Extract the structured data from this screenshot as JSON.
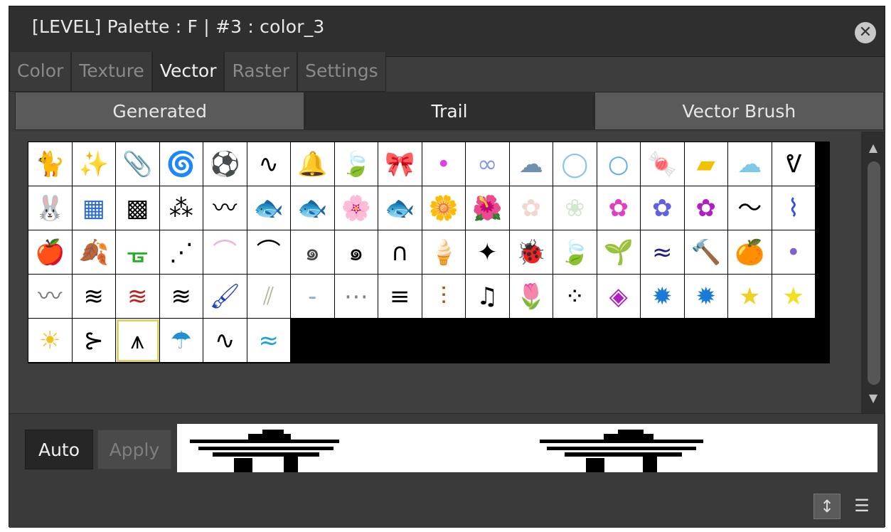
{
  "window": {
    "title": "[LEVEL]  Palette : F | #3 : color_3",
    "close_icon": "close-icon"
  },
  "tabs": [
    "Color",
    "Texture",
    "Vector",
    "Raster",
    "Settings"
  ],
  "active_tab": "Vector",
  "subtabs": [
    "Generated",
    "Trail",
    "Vector Brush"
  ],
  "active_subtab": "Trail",
  "brush_grid": {
    "selected_index": 74,
    "items": [
      {
        "glyph": "🐈",
        "color": "#000000"
      },
      {
        "glyph": "✨",
        "color": "#a020f0"
      },
      {
        "glyph": "📎",
        "color": "#b0b0b0"
      },
      {
        "glyph": "🌀",
        "color": "#555555"
      },
      {
        "glyph": "⚽",
        "color": "#000000"
      },
      {
        "glyph": "∿",
        "color": "#000000"
      },
      {
        "glyph": "🔔",
        "color": "#e0b050"
      },
      {
        "glyph": "🍃",
        "color": "#22a022"
      },
      {
        "glyph": "🎀",
        "color": "#6a6"
      },
      {
        "glyph": "•",
        "color": "#e040e0"
      },
      {
        "glyph": "∞",
        "color": "#8899dd"
      },
      {
        "glyph": "☁",
        "color": "#7090b0"
      },
      {
        "glyph": "◯",
        "color": "#88c4ee"
      },
      {
        "glyph": "○",
        "color": "#66b0e0"
      },
      {
        "glyph": "🍬",
        "color": "#e07010"
      },
      {
        "glyph": "▰",
        "color": "#f2c200"
      },
      {
        "glyph": "☁",
        "color": "#7ec8e8"
      },
      {
        "glyph": "ᕓ",
        "color": "#000000"
      },
      {
        "glyph": "🐰",
        "color": "#e07a30"
      },
      {
        "glyph": "▦",
        "color": "#2a6ad0"
      },
      {
        "glyph": "▩",
        "color": "#000000"
      },
      {
        "glyph": "⁂",
        "color": "#000000"
      },
      {
        "glyph": "〰",
        "color": "#000000"
      },
      {
        "glyph": "🐟",
        "color": "#f0a020"
      },
      {
        "glyph": "🐟",
        "color": "#e03030"
      },
      {
        "glyph": "🌸",
        "color": "#d040a0"
      },
      {
        "glyph": "🐟",
        "color": "#5ab0e0"
      },
      {
        "glyph": "🌼",
        "color": "#f060d0"
      },
      {
        "glyph": "🌺",
        "color": "#e02060"
      },
      {
        "glyph": "✿",
        "color": "#f0d8d0"
      },
      {
        "glyph": "❀",
        "color": "#d0e8d0"
      },
      {
        "glyph": "✿",
        "color": "#e040c0"
      },
      {
        "glyph": "✿",
        "color": "#6060e0"
      },
      {
        "glyph": "✿",
        "color": "#b020c0"
      },
      {
        "glyph": "〜",
        "color": "#000000"
      },
      {
        "glyph": "⌇",
        "color": "#3050e0"
      },
      {
        "glyph": "🍎",
        "color": "#e02020"
      },
      {
        "glyph": "🍂",
        "color": "#f0c000"
      },
      {
        "glyph": "ᚗ",
        "color": "#20b020"
      },
      {
        "glyph": "⋰",
        "color": "#000000"
      },
      {
        "glyph": "⌒",
        "color": "#f0b0e0"
      },
      {
        "glyph": "⌒",
        "color": "#000000"
      },
      {
        "glyph": "๑",
        "color": "#444444"
      },
      {
        "glyph": "๑",
        "color": "#000000"
      },
      {
        "glyph": "∩",
        "color": "#000000"
      },
      {
        "glyph": "🍦",
        "color": "#f0a0b0"
      },
      {
        "glyph": "✦",
        "color": "#000000"
      },
      {
        "glyph": "🐞",
        "color": "#c01020"
      },
      {
        "glyph": "🍃",
        "color": "#208040"
      },
      {
        "glyph": "🌱",
        "color": "#40c040"
      },
      {
        "glyph": "≈",
        "color": "#202080"
      },
      {
        "glyph": "🔨",
        "color": "#1a8ad8"
      },
      {
        "glyph": "🍊",
        "color": "#f08000"
      },
      {
        "glyph": "•",
        "color": "#8060d0"
      },
      {
        "glyph": "〰",
        "color": "#777777"
      },
      {
        "glyph": "≋",
        "color": "#000000"
      },
      {
        "glyph": "≋",
        "color": "#c02020"
      },
      {
        "glyph": "≋",
        "color": "#000000"
      },
      {
        "glyph": "🖌",
        "color": "#2040c0"
      },
      {
        "glyph": "⫽",
        "color": "#b0b8a0"
      },
      {
        "glyph": "-",
        "color": "#80b0d0"
      },
      {
        "glyph": "⋯",
        "color": "#808080"
      },
      {
        "glyph": "≡",
        "color": "#000000"
      },
      {
        "glyph": "⫶",
        "color": "#b05010"
      },
      {
        "glyph": "♫",
        "color": "#000000"
      },
      {
        "glyph": "🌷",
        "color": "#e02020"
      },
      {
        "glyph": "⁘",
        "color": "#000000"
      },
      {
        "glyph": "◈",
        "color": "#b020c0"
      },
      {
        "glyph": "✹",
        "color": "#1a7ad8"
      },
      {
        "glyph": "✹",
        "color": "#1a7ad8"
      },
      {
        "glyph": "★",
        "color": "#f0d020"
      },
      {
        "glyph": "★",
        "color": "#f0e020"
      },
      {
        "glyph": "☀",
        "color": "#f0c020"
      },
      {
        "glyph": "⊱",
        "color": "#000000"
      },
      {
        "glyph": "⩚",
        "color": "#000000"
      },
      {
        "glyph": "☂",
        "color": "#2090d0"
      },
      {
        "glyph": "∿",
        "color": "#000000"
      },
      {
        "glyph": "≈",
        "color": "#20a0e0"
      }
    ]
  },
  "buttons": {
    "auto": "Auto",
    "apply": "Apply"
  },
  "footer_icons": [
    "vertical-resize-icon",
    "list-menu-icon"
  ]
}
